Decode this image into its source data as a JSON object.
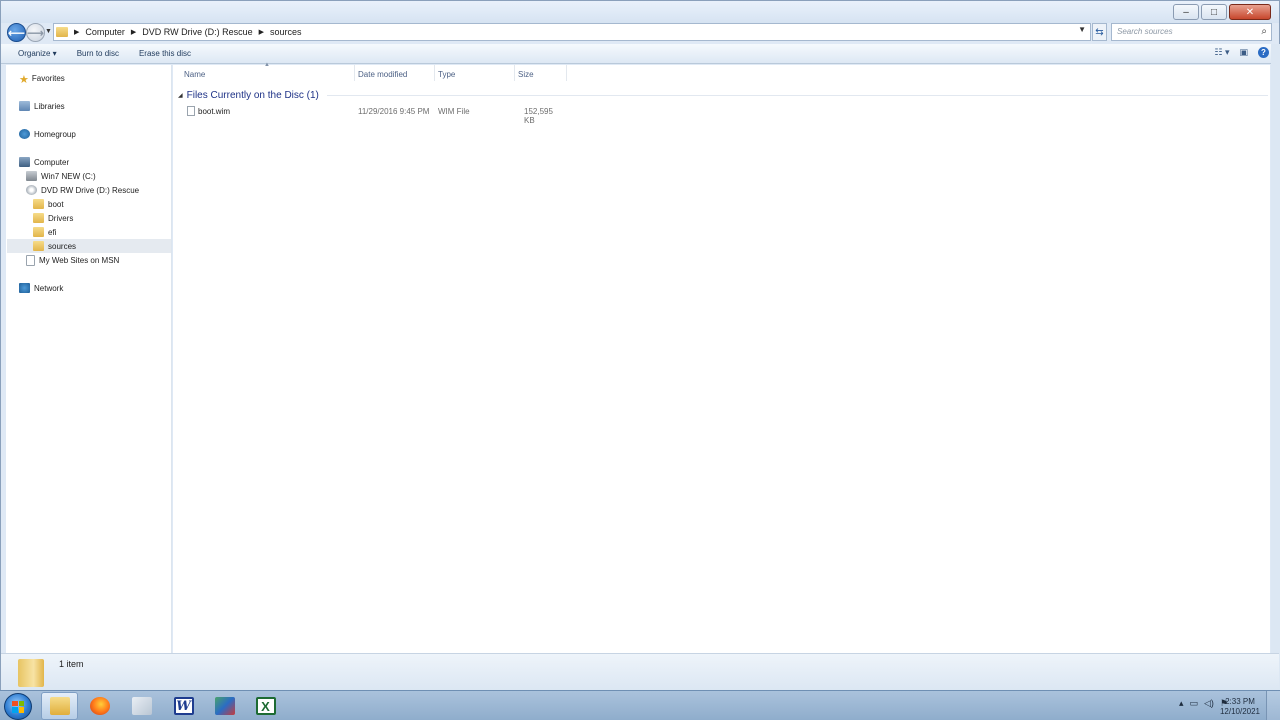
{
  "window": {
    "minimize": "–",
    "maximize": "□",
    "close": "✕"
  },
  "address": {
    "breadcrumbs": [
      "Computer",
      "DVD RW Drive (D:) Rescue",
      "sources"
    ],
    "search_placeholder": "Search sources"
  },
  "toolbar": {
    "organize": "Organize ▾",
    "burn": "Burn to disc",
    "erase": "Erase this disc"
  },
  "nav": {
    "favorites": "Favorites",
    "libraries": "Libraries",
    "homegroup": "Homegroup",
    "computer": "Computer",
    "win7": "Win7 NEW (C:)",
    "dvd": "DVD RW Drive (D:) Rescue",
    "boot": "boot",
    "drivers": "Drivers",
    "efi": "efi",
    "sources": "sources",
    "msn": "My Web Sites on MSN",
    "network": "Network"
  },
  "columns": {
    "name": "Name",
    "date": "Date modified",
    "type": "Type",
    "size": "Size"
  },
  "group": {
    "label": "Files Currently on the Disc (1)"
  },
  "files": [
    {
      "name": "boot.wim",
      "date": "11/29/2016 9:45 PM",
      "type": "WIM File",
      "size": "152,595 KB"
    }
  ],
  "status": {
    "count": "1 item"
  },
  "taskbar": {
    "word_letter": "W",
    "excel_letter": "X",
    "time": "2:33 PM",
    "date": "12/10/2021"
  }
}
